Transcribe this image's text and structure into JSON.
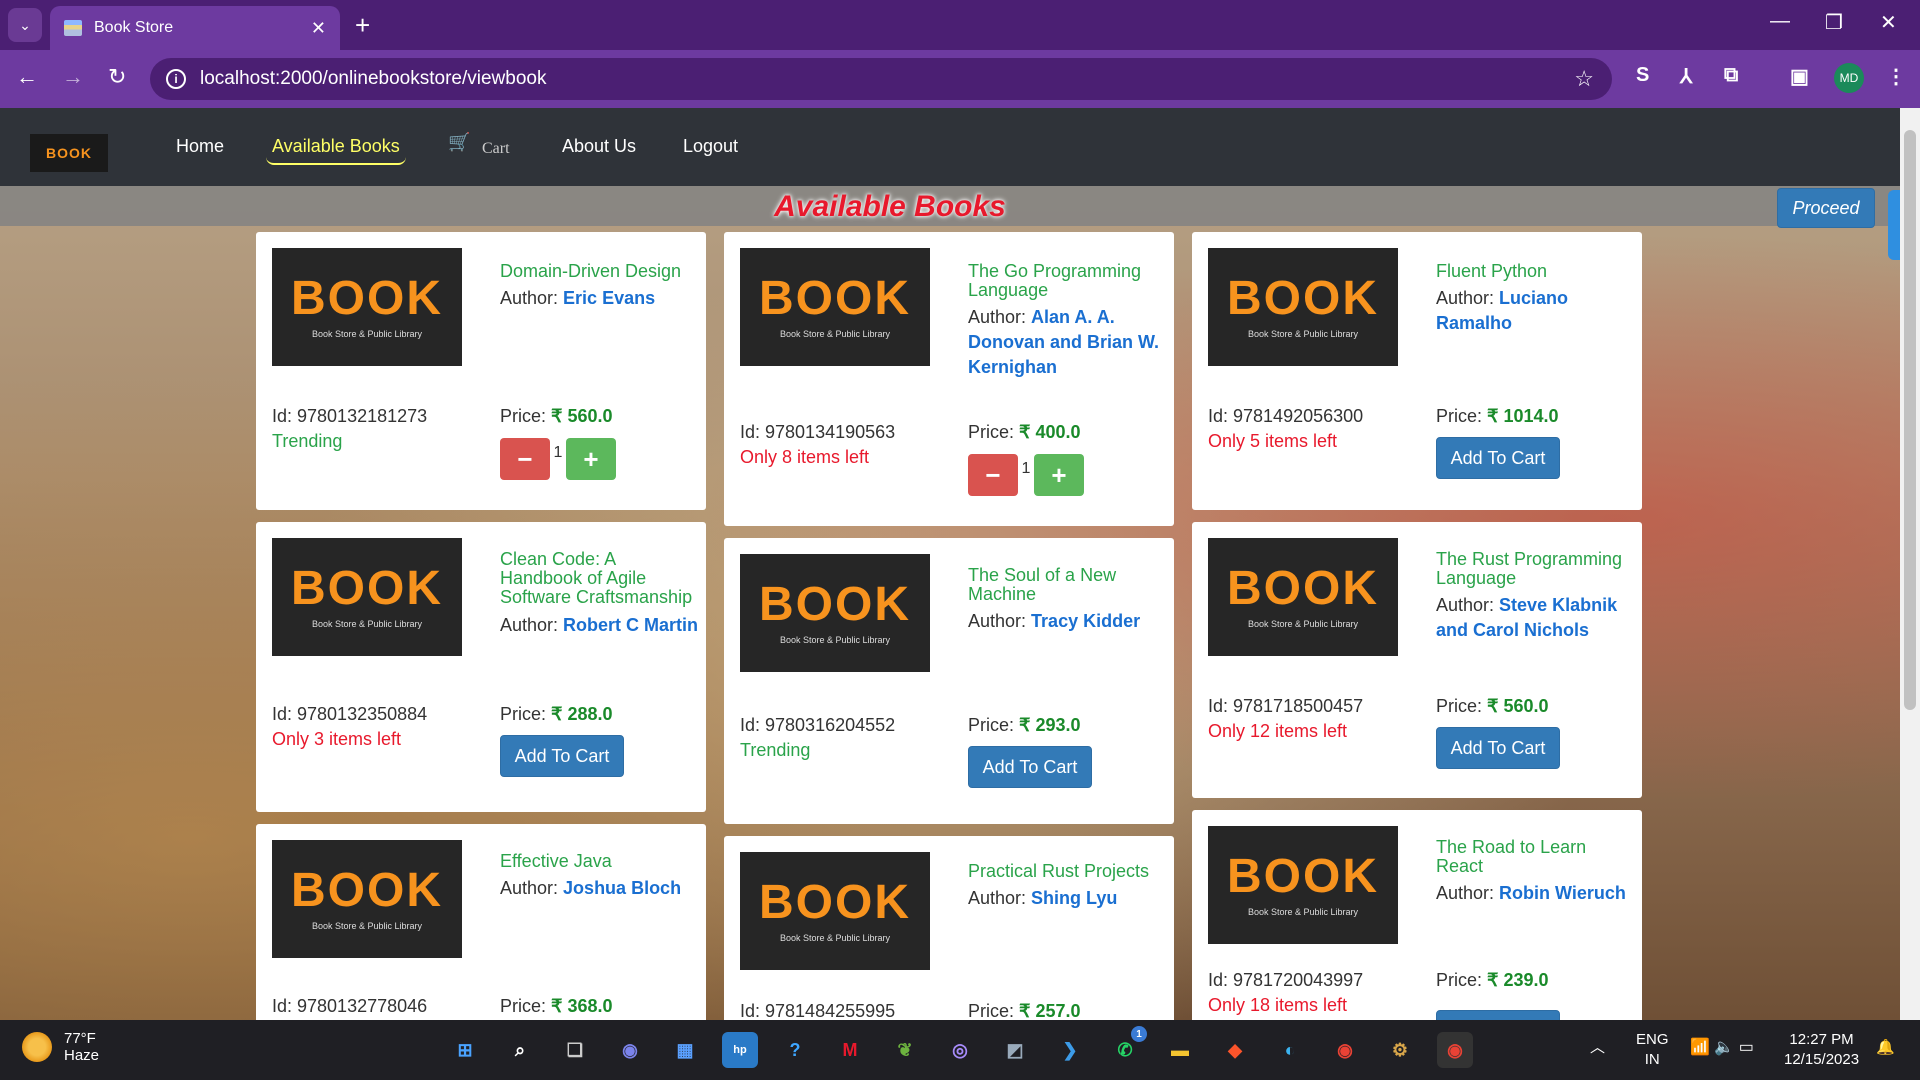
{
  "browser": {
    "tab_title": "Book Store",
    "url": "localhost:2000/onlinebookstore/viewbook",
    "profile_initials": "MD"
  },
  "nav": {
    "logo_text": "BOOK",
    "home": "Home",
    "available": "Available Books",
    "cart": "Cart",
    "about": "About Us",
    "logout": "Logout"
  },
  "page": {
    "title": "Available Books",
    "proceed": "Proceed"
  },
  "cover": {
    "brand": "BOOK",
    "tagline": "Book Store & Public Library"
  },
  "labels": {
    "author": "Author: ",
    "id": "Id: ",
    "price": "Price: ",
    "add_to_cart": "Add To Cart"
  },
  "books": [
    {
      "name": "Domain-Driven Design",
      "author": "Eric Evans",
      "id": "9780132181273",
      "price": "₹ 560.0",
      "status": "Trending",
      "qty": "1"
    },
    {
      "name": "The Go Programming Language",
      "author": "Alan A. A. Donovan and Brian W. Kernighan",
      "id": "9780134190563",
      "price": "₹ 400.0",
      "status": "Only 8 items left",
      "qty": "1"
    },
    {
      "name": "Fluent Python",
      "author": "Luciano Ramalho",
      "id": "9781492056300",
      "price": "₹ 1014.0",
      "status": "Only 5 items left"
    },
    {
      "name": "Clean Code: A Handbook of Agile Software Craftsmanship",
      "author": "Robert C Martin",
      "id": "9780132350884",
      "price": "₹ 288.0",
      "status": "Only 3 items left"
    },
    {
      "name": "The Soul of a New Machine",
      "author": "Tracy Kidder",
      "id": "9780316204552",
      "price": "₹ 293.0",
      "status": "Trending"
    },
    {
      "name": "The Rust Programming Language",
      "author": "Steve Klabnik and Carol Nichols",
      "id": "9781718500457",
      "price": "₹ 560.0",
      "status": "Only 12 items left"
    },
    {
      "name": "Effective Java",
      "author": "Joshua Bloch",
      "id": "9780132778046",
      "price": "₹ 368.0"
    },
    {
      "name": "Practical Rust Projects",
      "author": "Shing Lyu",
      "id": "9781484255995",
      "price": "₹ 257.0"
    },
    {
      "name": "The Road to Learn React",
      "author": "Robin Wieruch",
      "id": "9781720043997",
      "price": "₹ 239.0",
      "status": "Only 18 items left"
    }
  ],
  "taskbar": {
    "temp": "77°F",
    "weather": "Haze",
    "lang1": "ENG",
    "lang2": "IN",
    "time": "12:27 PM",
    "date": "12/15/2023",
    "badge": "1"
  }
}
